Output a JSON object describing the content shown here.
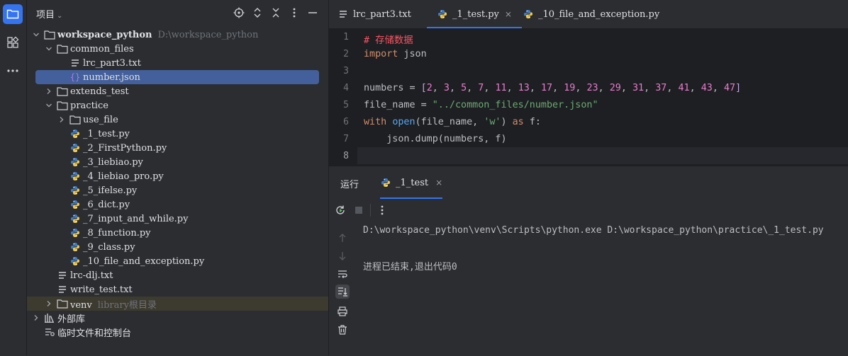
{
  "activity_bar": {
    "items": [
      {
        "name": "project-icon",
        "active": true
      },
      {
        "name": "structure-icon",
        "active": false
      },
      {
        "name": "more-icon",
        "active": false
      }
    ]
  },
  "project_panel": {
    "title": "项目",
    "tree": [
      {
        "label": "workspace_python",
        "hint": "D:\\workspace_python",
        "type": "folder",
        "expanded": true,
        "level": 0
      },
      {
        "label": "common_files",
        "type": "folder",
        "expanded": true,
        "level": 1
      },
      {
        "label": "lrc_part3.txt",
        "type": "txt",
        "level": 2
      },
      {
        "label": "number.json",
        "type": "json",
        "level": 2,
        "selected": true
      },
      {
        "label": "extends_test",
        "type": "folder",
        "expanded": false,
        "level": 1
      },
      {
        "label": "practice",
        "type": "folder",
        "expanded": true,
        "level": 1
      },
      {
        "label": "use_file",
        "type": "folder",
        "expanded": false,
        "level": 2
      },
      {
        "label": "_1_test.py",
        "type": "py",
        "level": 2
      },
      {
        "label": "_2_FirstPython.py",
        "type": "py",
        "level": 2
      },
      {
        "label": "_3_liebiao.py",
        "type": "py",
        "level": 2
      },
      {
        "label": "_4_liebiao_pro.py",
        "type": "py",
        "level": 2
      },
      {
        "label": "_5_ifelse.py",
        "type": "py",
        "level": 2
      },
      {
        "label": "_6_dict.py",
        "type": "py",
        "level": 2
      },
      {
        "label": "_7_input_and_while.py",
        "type": "py",
        "level": 2
      },
      {
        "label": "_8_function.py",
        "type": "py",
        "level": 2
      },
      {
        "label": "_9_class.py",
        "type": "py",
        "level": 2
      },
      {
        "label": "_10_file_and_exception.py",
        "type": "py",
        "level": 2
      },
      {
        "label": "lrc-dlj.txt",
        "type": "txt",
        "level": 1
      },
      {
        "label": "write_test.txt",
        "type": "txt",
        "level": 1
      },
      {
        "label": "venv",
        "hint": "library根目录",
        "type": "folder",
        "expanded": false,
        "level": 1
      },
      {
        "label": "外部库",
        "type": "lib",
        "expanded": false,
        "level": 0
      },
      {
        "label": "临时文件和控制台",
        "type": "scratch",
        "level": 0
      }
    ]
  },
  "editor": {
    "tabs": [
      {
        "label": "lrc_part3.txt",
        "type": "txt",
        "active": false
      },
      {
        "label": "_1_test.py",
        "type": "py",
        "active": true,
        "close": "×"
      },
      {
        "label": "_10_file_and_exception.py",
        "type": "py",
        "active": false
      }
    ],
    "line_numbers": [
      "1",
      "2",
      "3",
      "4",
      "5",
      "6",
      "7",
      "8"
    ],
    "current_line": 8
  },
  "run_panel": {
    "label": "运行",
    "tab": "_1_test",
    "tab_close": "×",
    "output_command": "D:\\workspace_python\\venv\\Scripts\\python.exe D:\\workspace_python\\practice\\_1_test.py",
    "output_exit": "进程已结束,退出代码0"
  }
}
